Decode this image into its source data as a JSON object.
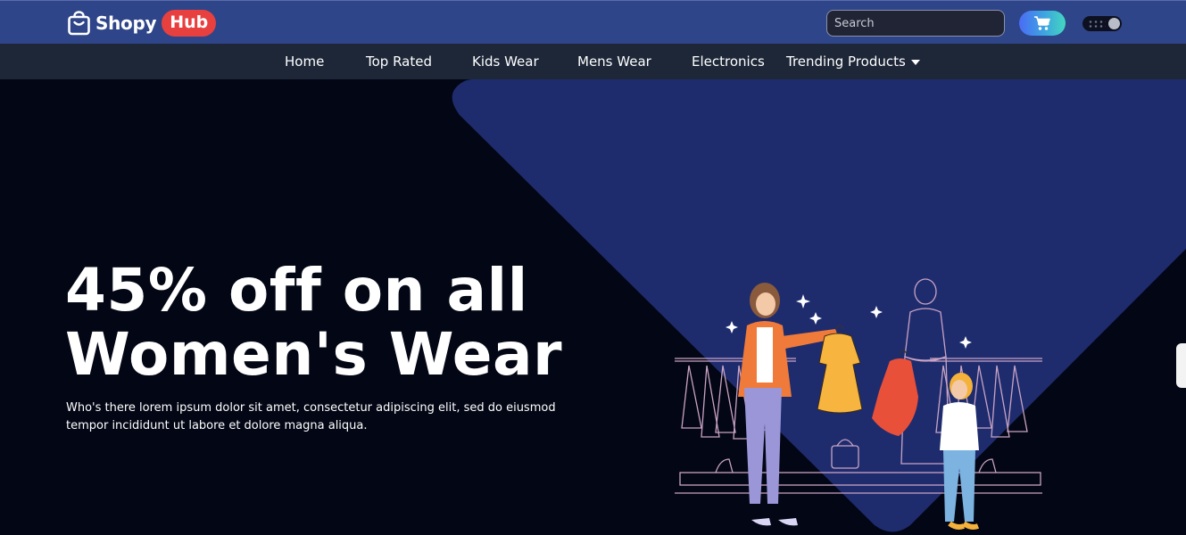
{
  "header": {
    "brand_name": "Shopy",
    "brand_badge": "Hub",
    "search_placeholder": "Search",
    "cart_icon": "cart-icon",
    "logo_icon": "shopping-bag-icon",
    "theme_toggle_icon": "moon-toggle-icon"
  },
  "nav": {
    "items": [
      "Home",
      "Top Rated",
      "Kids Wear",
      "Mens Wear",
      "Electronics"
    ],
    "dropdown_label": "Trending Products",
    "dropdown_icon": "caret-down-icon"
  },
  "hero": {
    "title_line1": "45% off on all",
    "title_line2": "Women's Wear",
    "description": "Who's there lorem ipsum dolor sit amet, consectetur adipiscing elit, sed do eiusmod tempor incididunt ut labore et dolore magna aliqua.",
    "illustration": "shopping-illustration"
  },
  "colors": {
    "header_bg": "#2f4589",
    "nav_bg": "#1d2738",
    "hero_bg": "#030614",
    "hero_shape": "#1e2c6e",
    "badge": "#e8403f",
    "cart_gradient_start": "#4a6cf5",
    "cart_gradient_end": "#43d6c0"
  }
}
